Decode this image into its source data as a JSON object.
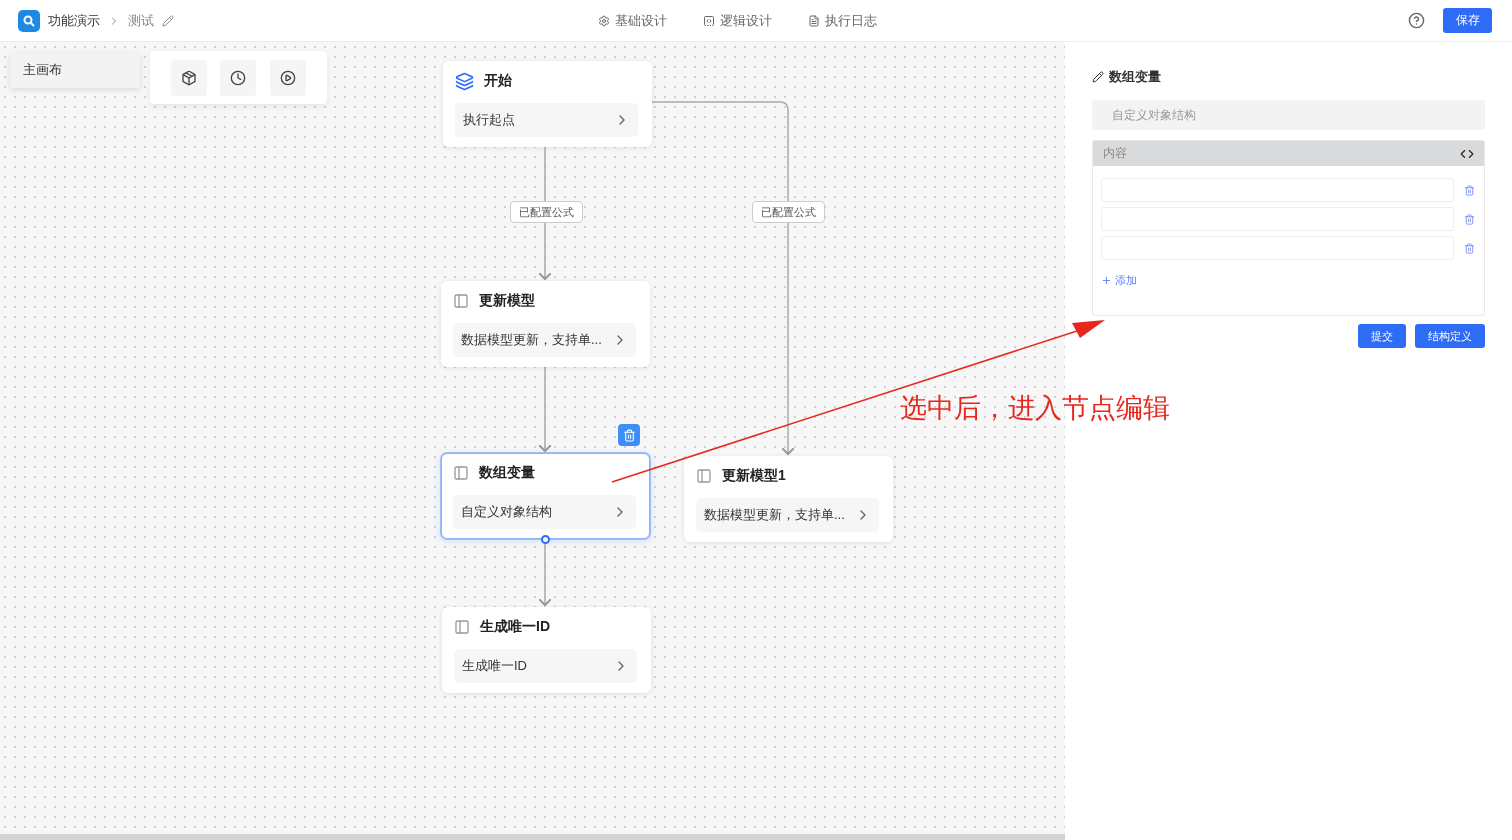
{
  "header": {
    "app_name": "功能演示",
    "page_name": "测试",
    "tabs": [
      {
        "kind": "basic",
        "label": "基础设计"
      },
      {
        "kind": "logic",
        "label": "逻辑设计"
      },
      {
        "kind": "log",
        "label": "执行日志"
      }
    ],
    "save_button": "保存"
  },
  "canvas": {
    "canvas_tab": "主画布",
    "nodes": [
      {
        "kind": "start",
        "title": "开始",
        "subtitle": "执行起点",
        "selected": false
      },
      {
        "kind": "task",
        "title": "更新模型",
        "subtitle": "数据模型更新，支持单...",
        "selected": false
      },
      {
        "kind": "task",
        "title": "数组变量",
        "subtitle": "自定义对象结构",
        "selected": true
      },
      {
        "kind": "task",
        "title": "生成唯一ID",
        "subtitle": "生成唯一ID",
        "selected": false
      },
      {
        "kind": "task",
        "title": "更新模型1",
        "subtitle": "数据模型更新，支持单...",
        "selected": false
      }
    ],
    "edge_labels": [
      "已配置公式",
      "已配置公式"
    ]
  },
  "panel": {
    "title": "数组变量",
    "name_value": "自定义对象结构",
    "section_title": "内容",
    "fields": [
      {
        "kind": "input"
      },
      {
        "kind": "input"
      },
      {
        "kind": "input"
      }
    ],
    "add_link": "添加",
    "buttons": [
      "提交",
      "结构定义"
    ]
  },
  "annotation": {
    "text": "选中后，进入节点编辑"
  }
}
